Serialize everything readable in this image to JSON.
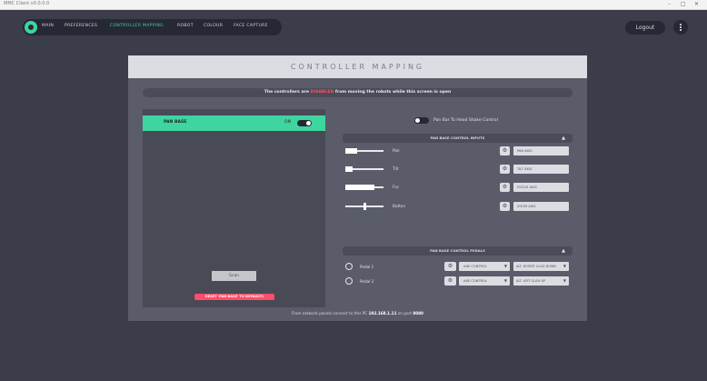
{
  "window": {
    "title": "MMC Client v0.0.0.0",
    "controls": [
      "–",
      "□",
      "✕"
    ]
  },
  "nav": {
    "items": [
      {
        "label": "MAIN",
        "active": false
      },
      {
        "label": "PREFERENCES",
        "active": false
      },
      {
        "label": "CONTROLLER MAPPING",
        "active": true
      },
      {
        "label": "ROBOT",
        "active": false
      },
      {
        "label": "COLOUR",
        "active": false
      },
      {
        "label": "FACE CAPTURE",
        "active": false
      }
    ],
    "logout_label": "Logout"
  },
  "panel": {
    "title": "CONTROLLER MAPPING",
    "warning": {
      "prefix": "The controllers are ",
      "highlight": "DISABLED",
      "suffix": " from moving the robots while this screen is open"
    },
    "devices": [
      {
        "name": "PAN BASE",
        "state_label": "ON",
        "enabled": true
      }
    ],
    "scan_label": "Scan",
    "reset_label": "RESET 'PAN BASE' TO DEFAULTS",
    "deadman": {
      "label": "Pan Bar To Head Shake Control",
      "enabled": false
    },
    "inputs_section": "PAN BASE CONTROL INPUTS",
    "inputs": [
      {
        "name": "Pan",
        "level": 0.3,
        "mapping": "PAN AXIS"
      },
      {
        "name": "Tilt",
        "level": 0.2,
        "mapping": "TILT AXIS"
      },
      {
        "name": "Foc",
        "level": 0.75,
        "mapping": "FOCUS AXIS"
      },
      {
        "name": "Button",
        "level": 0.5,
        "mapping": "ZOOM AXIS"
      }
    ],
    "pedals_section": "PAN BASE CONTROL PEDALS",
    "pedals": [
      {
        "name": "Pedal 1",
        "control": "AXE CONTROL",
        "axis": "ALT. ROTATE CLICK DOWN"
      },
      {
        "name": "Pedal 2",
        "control": "AXE CONTROL",
        "axis": "ALT. LEFT CLICK UP"
      }
    ],
    "footnote": {
      "prefix": "From network panels connect to this PC ",
      "ip": "192.168.1.11",
      "middle": " on port ",
      "port": "8080"
    }
  },
  "icons": {
    "home": "home-icon",
    "kebab": "more-vert-icon",
    "gear": "gear-icon",
    "chevron": "chevron-up-icon",
    "dropdown": "dropdown-arrow-icon"
  },
  "colors": {
    "accent": "#3ed5a0",
    "danger": "#ff4d6a",
    "background": "#3c3d4a",
    "panel": "#5a5c6a"
  }
}
